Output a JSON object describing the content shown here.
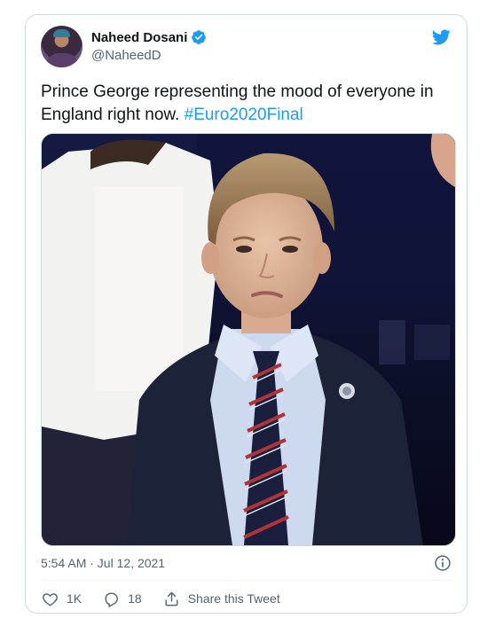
{
  "author": {
    "display_name": "Naheed Dosani",
    "handle": "@NaheedD"
  },
  "tweet": {
    "text": "Prince George representing the mood of everyone in England right now. ",
    "hashtag": "#Euro2020Final",
    "timestamp": "5:54 AM · Jul 12, 2021"
  },
  "actions": {
    "like_count": "1K",
    "reply_count": "18",
    "share_label": "Share this Tweet"
  },
  "colors": {
    "accent": "#1d9bf0",
    "secondary_text": "#536471",
    "border": "#cfd9de"
  },
  "icons": [
    "verified-badge-icon",
    "twitter-bird-icon",
    "info-icon",
    "heart-icon",
    "reply-icon",
    "share-icon"
  ]
}
